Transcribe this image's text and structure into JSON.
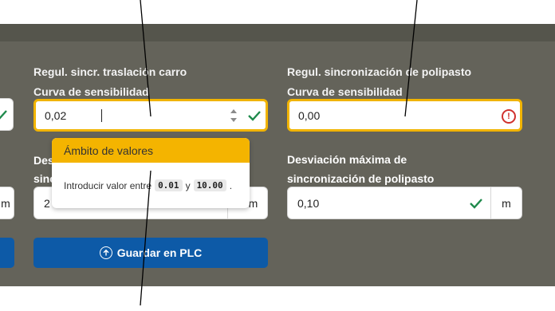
{
  "carriage": {
    "title_line1": "Regul. sincr. traslación carro",
    "title_line2": "Curva de sensibilidad",
    "value": "0,02",
    "deviation_label_line1": "Des",
    "deviation_label_line2": "sinc",
    "deviation_value": "2",
    "deviation_unit": "m"
  },
  "hoist": {
    "title_line1": "Regul. sincronización de polipasto",
    "title_line2": "Curva de sensibilidad",
    "value": "0,00",
    "deviation_label_line1": "Desviación máxima de",
    "deviation_label_line2": "sincronización de polipasto",
    "deviation_value": "0,10",
    "deviation_unit": "m"
  },
  "left_column": {
    "unit": "m"
  },
  "popover": {
    "title": "Ámbito de valores",
    "text_before": "Introducir valor entre",
    "min": "0.01",
    "conjunction": "y",
    "max": "10.00",
    "text_after": "."
  },
  "save_button": {
    "label": "Guardar en PLC"
  },
  "colors": {
    "panel": "#64635a",
    "focus_border": "#f1b400",
    "popover_header": "#f4b400",
    "button": "#0d5aa7",
    "check": "#1f8a4c",
    "error": "#d0312d"
  }
}
